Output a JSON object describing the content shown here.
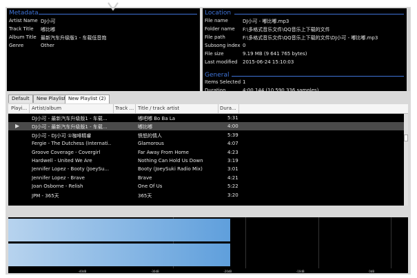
{
  "metadata": {
    "header": "Metadata",
    "rows": [
      {
        "label": "Artist Name",
        "value": "DJ小可"
      },
      {
        "label": "Track Title",
        "value": "嘟比嘟"
      },
      {
        "label": "Album Title",
        "value": "最新汽车升级版1 - 车载低音炮"
      },
      {
        "label": "Genre",
        "value": "Other"
      }
    ]
  },
  "location": {
    "header": "Location",
    "rows": [
      {
        "label": "File name",
        "value": "DJ小可 - 嘟比嘟.mp3"
      },
      {
        "label": "Folder name",
        "value": "F:\\多格式音乐文件\\QQ音乐上下载的文件"
      },
      {
        "label": "File path",
        "value": "F:\\多格式音乐文件\\QQ音乐上下载的文件\\DJ小可 - 嘟比嘟.mp3"
      },
      {
        "label": "Subsong index",
        "value": "0"
      },
      {
        "label": "File size",
        "value": "9.19 MB (9 641 765 bytes)"
      },
      {
        "label": "Last modified",
        "value": "2015-06-24 15:10:03"
      }
    ],
    "general_header": "General",
    "general_rows": [
      {
        "label": "Items Selected",
        "value": "1"
      },
      {
        "label": "Duration",
        "value": "4:00.144 (10 590 336 samples)"
      }
    ]
  },
  "tabs": [
    "Default",
    "New Playlist",
    "New Playlist (2)"
  ],
  "columns": [
    "Playi...",
    "Artist/album",
    "Track ...",
    "Title / track artist",
    "Dura..."
  ],
  "playing_icon": "play-indicator",
  "rows": [
    {
      "artist": "DJ小可 - 最新汽车升级版1 - 车载...",
      "title": "嘟吧嘟 Bo Ba La",
      "duration": "5:31",
      "playing": false,
      "selected": false
    },
    {
      "artist": "DJ小可 - 最新汽车升级版1 - 车载...",
      "title": "嘟比嘟",
      "duration": "4:00",
      "playing": true,
      "selected": true
    },
    {
      "artist": "DJ小可 - DJ小可 ①咖啡精睿",
      "title": "愤怒的情人",
      "duration": "5:39",
      "playing": false,
      "selected": false
    },
    {
      "artist": "Fergie - The Dutchess (Internati...",
      "title": "Glamorous",
      "duration": "4:07",
      "playing": false,
      "selected": false
    },
    {
      "artist": "Groove Coverage - Covergirl",
      "title": "Far Away From Home",
      "duration": "4:23",
      "playing": false,
      "selected": false
    },
    {
      "artist": "Hardwell - United We Are",
      "title": "Nothing Can Hold Us Down",
      "duration": "3:19",
      "playing": false,
      "selected": false
    },
    {
      "artist": "Jennifer Lopez - Booty (JoeySu...",
      "title": "Booty (JoeySuki Radio Mix)",
      "duration": "3:01",
      "playing": false,
      "selected": false
    },
    {
      "artist": "Jennifer Lopez - Brave",
      "title": "Brave",
      "duration": "4:21",
      "playing": false,
      "selected": false
    },
    {
      "artist": "Joan Osborne - Relish",
      "title": "One Of Us",
      "duration": "5:22",
      "playing": false,
      "selected": false
    },
    {
      "artist": "JPM - 365天",
      "title": "365天",
      "duration": "3:20",
      "playing": false,
      "selected": false
    }
  ],
  "vu": {
    "scale": [
      "-40dB",
      "-30dB",
      "-20dB",
      "-10dB",
      "0dB"
    ],
    "levels_db": [
      -20,
      -20
    ]
  }
}
